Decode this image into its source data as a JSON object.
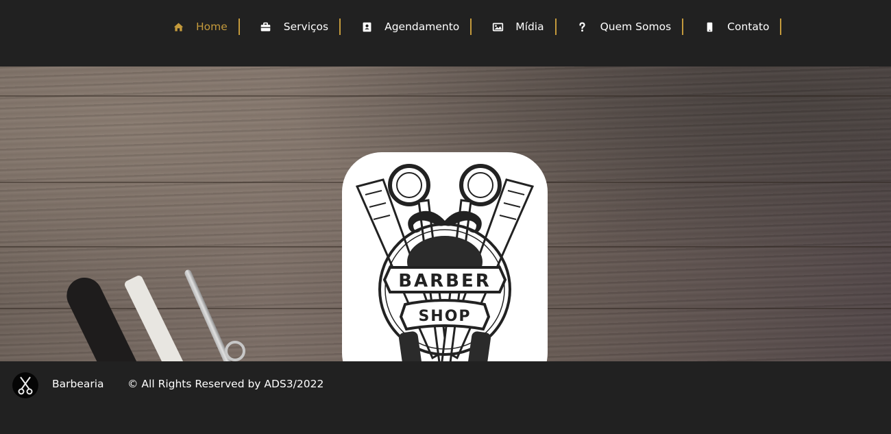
{
  "nav": {
    "items": [
      {
        "label": "Home",
        "icon": "home-icon",
        "active": true
      },
      {
        "label": "Serviços",
        "icon": "briefcase-icon",
        "active": false
      },
      {
        "label": "Agendamento",
        "icon": "contact-book-icon",
        "active": false
      },
      {
        "label": "Mídia",
        "icon": "image-icon",
        "active": false
      },
      {
        "label": "Quem Somos",
        "icon": "question-icon",
        "active": false
      },
      {
        "label": "Contato",
        "icon": "mobile-phone-icon",
        "active": false
      }
    ]
  },
  "hero": {
    "logo": {
      "line1": "BARBER",
      "line2": "SHOP"
    }
  },
  "footer": {
    "logo_icon": "scissors-icon",
    "brand": "Barbearia",
    "copyright": "© All Rights Reserved by ADS3/2022"
  },
  "colors": {
    "accent": "#c49a3c",
    "background": "#212121",
    "text": "#ffffff"
  }
}
